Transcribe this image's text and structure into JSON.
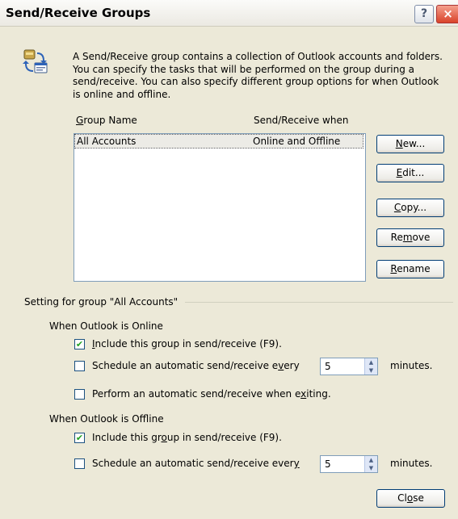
{
  "window": {
    "title": "Send/Receive Groups",
    "help_label": "?",
    "close_label": "×"
  },
  "description": "A Send/Receive group contains a collection of Outlook accounts and folders. You can specify the tasks that will be performed on the group during a send/receive. You can also specify different group options for when Outlook is online and offline.",
  "list": {
    "col_name": "Group Name",
    "col_when": "Send/Receive when",
    "rows": [
      {
        "name": "All Accounts",
        "when": "Online and Offline"
      }
    ]
  },
  "buttons": {
    "new": "New...",
    "edit": "Edit...",
    "copy": "Copy...",
    "remove": "Remove",
    "rename": "Rename",
    "close": "Close"
  },
  "settings": {
    "group_label": "Setting for group \"All Accounts\"",
    "online": {
      "header": "When Outlook is Online",
      "include_label": "Include this group in send/receive (F9).",
      "include_checked": true,
      "schedule_label": "Schedule an automatic send/receive every",
      "schedule_checked": false,
      "minutes_value": "5",
      "minutes_label": "minutes.",
      "exit_label": "Perform an automatic send/receive when exiting.",
      "exit_checked": false
    },
    "offline": {
      "header": "When Outlook is Offline",
      "include_label": "Include this group in send/receive (F9).",
      "include_checked": true,
      "schedule_label": "Schedule an automatic send/receive every",
      "schedule_checked": false,
      "minutes_value": "5",
      "minutes_label": "minutes."
    }
  },
  "icons": {
    "title_help": "help-icon",
    "title_close": "close-icon",
    "dialog": "send-receive-icon",
    "checkbox": "check-icon",
    "spinner": "spin-arrows-icon"
  }
}
